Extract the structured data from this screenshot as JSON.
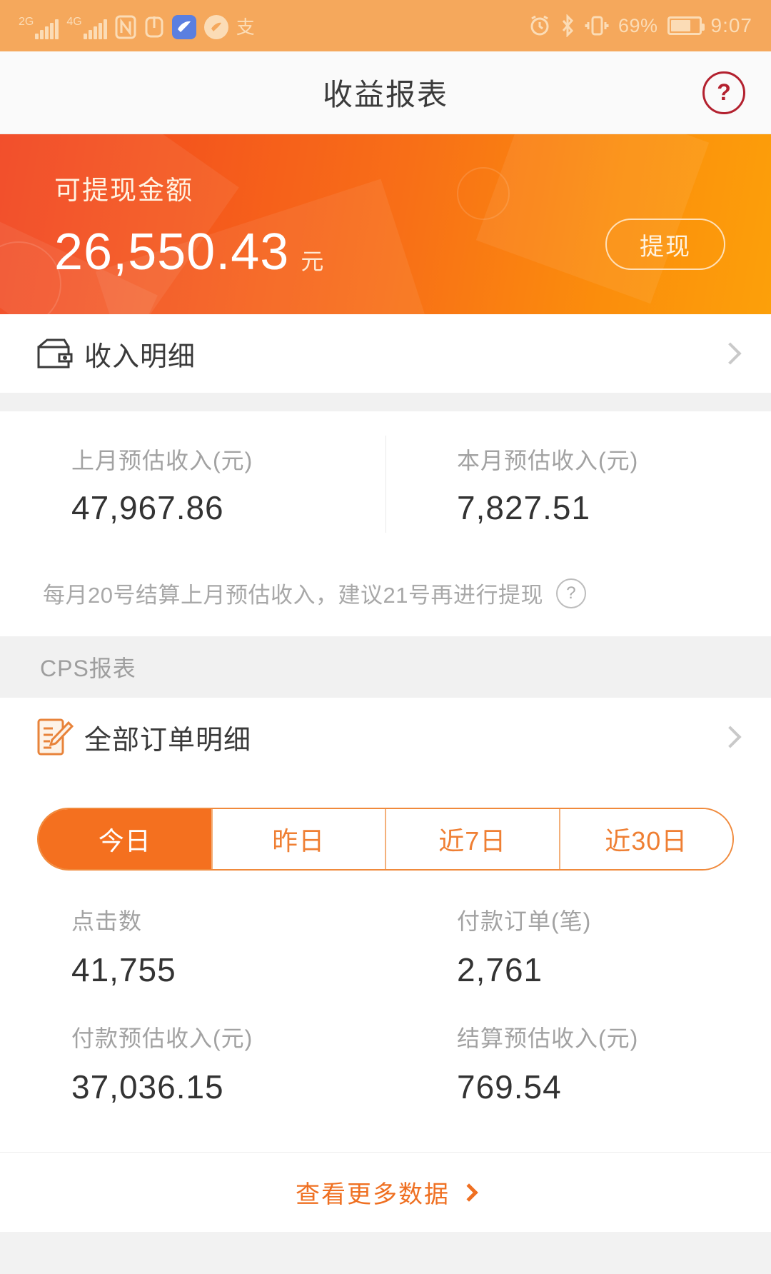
{
  "statusbar": {
    "network_gen_1": "2G",
    "network_gen_2": "4G",
    "battery_percent": "69%",
    "time": "9:07",
    "icons": [
      "signal-bars-icon",
      "signal-bars-icon",
      "nfc-icon",
      "vpn-icon",
      "app-blue-icon",
      "app-circle-icon",
      "alipay-icon",
      "alarm-icon",
      "bluetooth-icon",
      "vibrate-icon",
      "battery-icon"
    ]
  },
  "header": {
    "title": "收益报表",
    "help_label": "?"
  },
  "hero": {
    "label": "可提现金额",
    "amount": "26,550.43",
    "unit": "元",
    "withdraw_button": "提现",
    "gradient_start": "#f2421c",
    "gradient_end": "#fca00a"
  },
  "income_row": {
    "label": "收入明细",
    "icon": "wallet-icon"
  },
  "monthly": {
    "left": {
      "label": "上月预估收入(元)",
      "value": "47,967.86"
    },
    "right": {
      "label": "本月预估收入(元)",
      "value": "7,827.51"
    }
  },
  "notice": {
    "text": "每月20号结算上月预估收入，建议21号再进行提现",
    "help_label": "?"
  },
  "cps": {
    "section_title": "CPS报表",
    "orders_row": {
      "label": "全部订单明细",
      "icon": "order-note-icon"
    },
    "tabs": [
      {
        "label": "今日",
        "active": true
      },
      {
        "label": "昨日",
        "active": false
      },
      {
        "label": "近7日",
        "active": false
      },
      {
        "label": "近30日",
        "active": false
      }
    ],
    "metrics": [
      {
        "label": "点击数",
        "value": "41,755"
      },
      {
        "label": "付款订单(笔)",
        "value": "2,761"
      },
      {
        "label": "付款预估收入(元)",
        "value": "37,036.15"
      },
      {
        "label": "结算预估收入(元)",
        "value": "769.54"
      }
    ],
    "more_link": "查看更多数据"
  },
  "colors": {
    "accent_orange": "#f4701f",
    "status_bar_bg": "#f5a85c",
    "help_red": "#b3212f"
  }
}
